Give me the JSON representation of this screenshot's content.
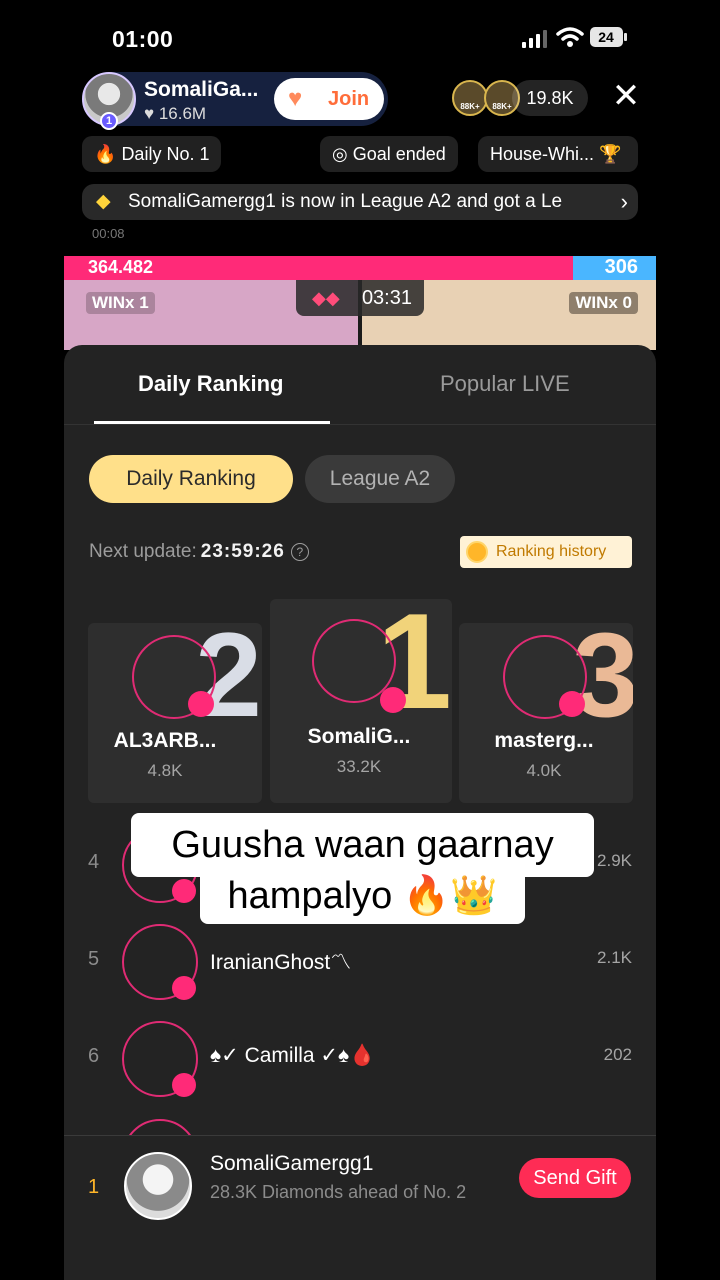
{
  "status_bar": {
    "time": "01:00",
    "battery": "24"
  },
  "host": {
    "name": "SomaliGa...",
    "likes": "16.6M",
    "rank_badge": "1",
    "join_label": "Join"
  },
  "viewers": {
    "badge_a": "88K+",
    "badge_b": "88K+",
    "count": "19.8K"
  },
  "pills": {
    "daily": "Daily No. 1",
    "goal": "Goal ended",
    "house": "House-Whi..."
  },
  "banner": {
    "text": "SomaliGamergg1 is now in League A2 and got a Le"
  },
  "stamp": "00:08",
  "battle": {
    "left_score": "364.482",
    "right_score": "306",
    "timer": "03:31",
    "left_win": "WINx 1",
    "right_win": "WINx 0"
  },
  "tabs": {
    "active": "Daily Ranking",
    "inactive": "Popular LIVE"
  },
  "segments": {
    "on": "Daily Ranking",
    "off": "League A2"
  },
  "next_update": {
    "label": "Next update:",
    "time": "23:59:26",
    "history_label": "Ranking history"
  },
  "podium": [
    {
      "rank": "2",
      "name": "AL3ARB...",
      "score": "4.8K"
    },
    {
      "rank": "1",
      "name": "SomaliG...",
      "score": "33.2K"
    },
    {
      "rank": "3",
      "name": "masterg...",
      "score": "4.0K"
    }
  ],
  "list": [
    {
      "rank": "4",
      "name": "",
      "score": "2.9K"
    },
    {
      "rank": "5",
      "name": "IranianGhost〽",
      "score": "2.1K"
    },
    {
      "rank": "6",
      "name": "♠✓ Camilla ✓♠🩸",
      "score": "202"
    }
  ],
  "caption": {
    "line1": "Guusha waan gaarnay",
    "line2": "hampalyo 🔥👑"
  },
  "me": {
    "rank": "1",
    "name": "SomaliGamergg1",
    "sub": "28.3K Diamonds ahead of No. 2",
    "gift_label": "Send Gift"
  },
  "colors": {
    "accent_pink": "#ff2a78",
    "gold_segment": "#ffe08a",
    "send_gift": "#fe2c55",
    "battle_blue": "#4ab6ff"
  }
}
